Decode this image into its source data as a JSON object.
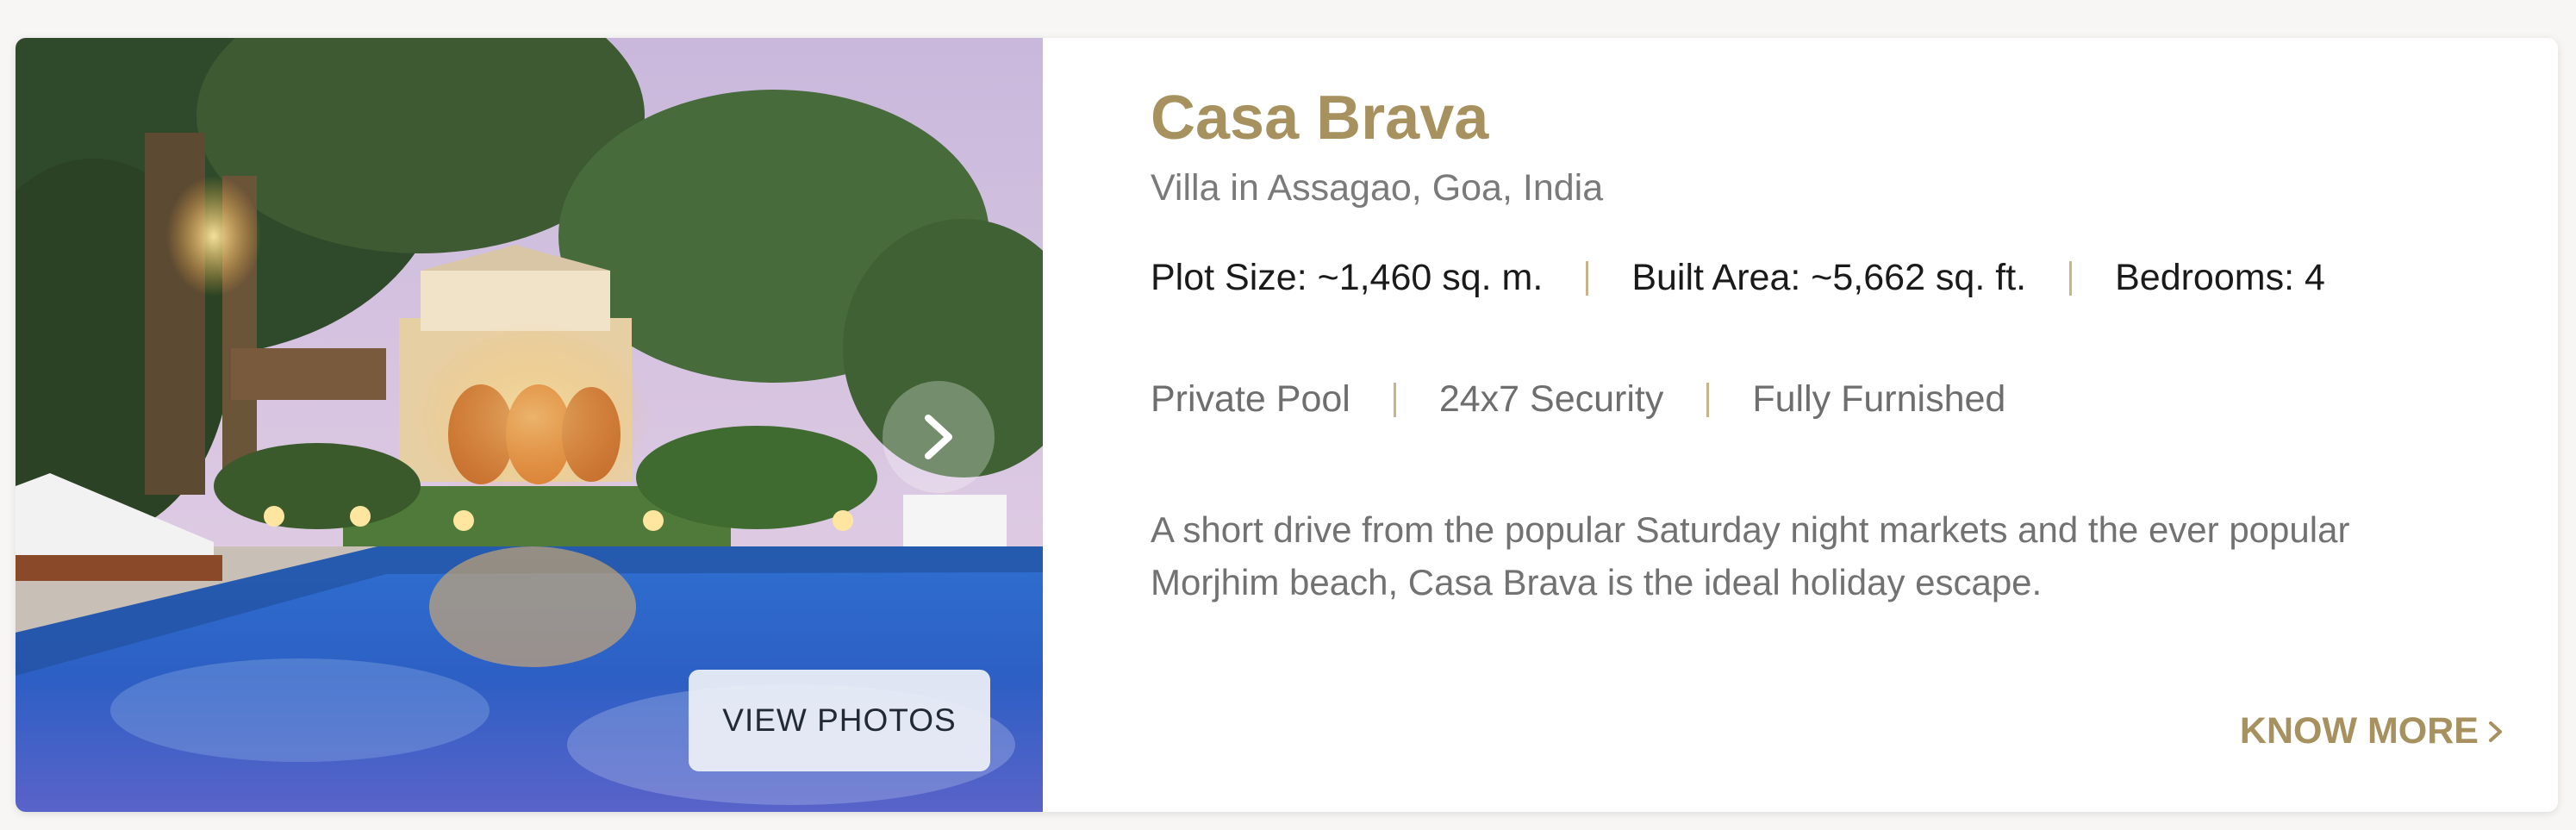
{
  "property": {
    "name": "Casa Brava",
    "subtitle": "Villa in Assagao, Goa, India",
    "specs": [
      "Plot Size: ~1,460 sq. m.",
      "Built Area: ~5,662 sq. ft.",
      "Bedrooms: 4"
    ],
    "amenities": [
      "Private Pool",
      "24x7 Security",
      "Fully Furnished"
    ],
    "description": "A short drive from the popular Saturday night markets and the ever popular Morjhim beach, Casa Brava is the ideal holiday escape."
  },
  "gallery": {
    "view_photos_label": "VIEW PHOTOS",
    "next_icon": "chevron-right-icon"
  },
  "cta": {
    "know_more_label": "KNOW MORE",
    "chevron_icon": "chevron-right-icon"
  },
  "colors": {
    "accent_gold": "#a6915f",
    "separator": "#c9b48a",
    "card_bg": "#ffffff",
    "page_bg": "#f7f6f4"
  }
}
